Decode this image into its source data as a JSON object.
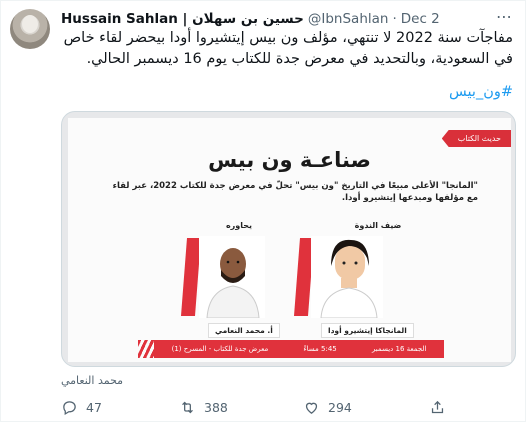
{
  "tweet": {
    "display_name": "Hussain Sahlan | حسين بن سهلان",
    "handle": "@IbnSahlan",
    "separator": "·",
    "date": "Dec 2",
    "more_icon": "more-horizontal-icon",
    "text": "مفاجآت سنة 2022 لا تنتهي، مؤلف ون بيس إيتشيروا أودا بيحضر لقاء خاص في السعودية، وبالتحديد في معرض جدة للكتاب يوم 16 ديسمبر الحالي.",
    "hashtag": "#ون_بيس",
    "media_caption": "محمد النعامي"
  },
  "poster": {
    "ribbon": "حديث الكتاب",
    "title": "صناعـة ون بيس",
    "description": "\"المانجا\" الأعلى مبيعًا في التاريخ \"ون بيس\" تحلّ في معرض جدة للكتاب 2022، عبر لقاء مع مؤلفها ومبدعها إيتشيرو أودا.",
    "guest_label": "ضيف الندوة",
    "host_label": "يحاوره",
    "guest_name": "المانجاكا إيتشيرو أودا",
    "host_name": "أ. محمد النعامي",
    "footer": {
      "date": "الجمعة 16 ديسمبر",
      "time": "5:45 مساءً",
      "venue": "معرض جدة للكتاب - المسرح (1)"
    },
    "accent_color": "#e0323c"
  },
  "actions": {
    "reply_count": "47",
    "retweet_count": "388",
    "like_count": "294",
    "reply_icon": "reply-icon",
    "retweet_icon": "retweet-icon",
    "like_icon": "heart-icon",
    "share_icon": "share-icon"
  }
}
